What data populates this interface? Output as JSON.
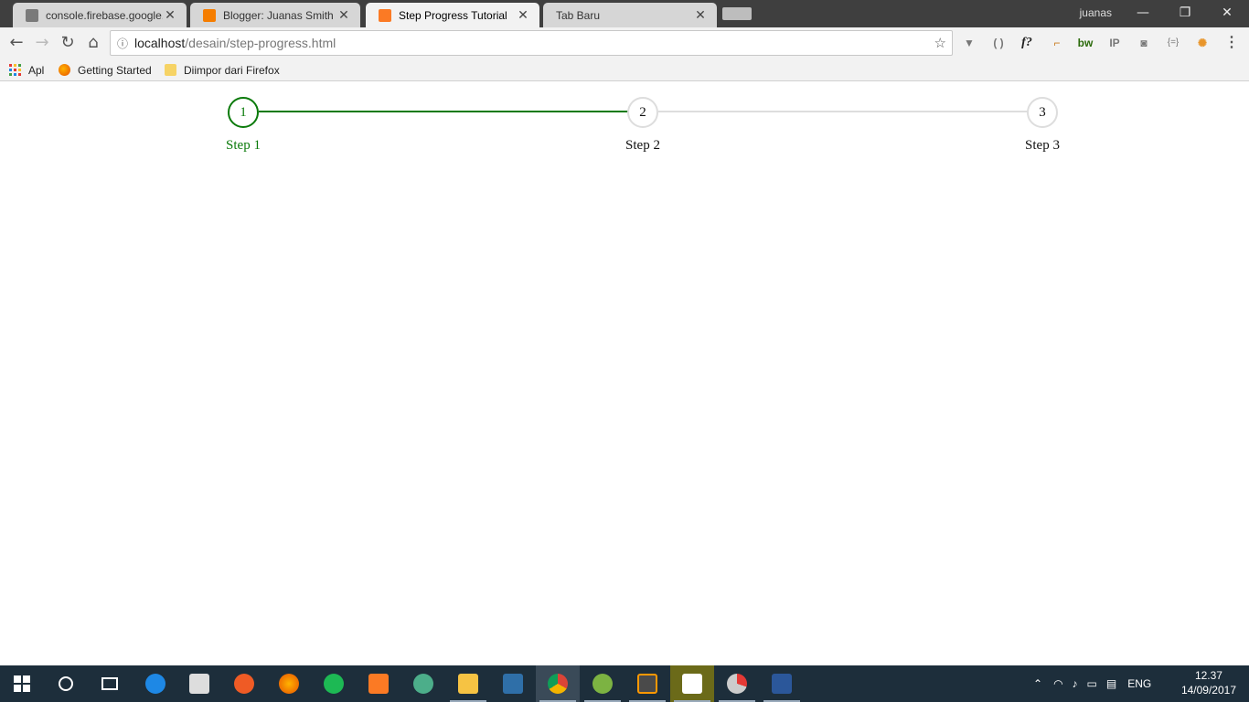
{
  "browser": {
    "tabs": [
      {
        "title": "console.firebase.google.c",
        "favicon": "firebase-icon"
      },
      {
        "title": "Blogger: Juanas Smith Sh",
        "favicon": "blogger-icon"
      },
      {
        "title": "Step Progress Tutorial",
        "favicon": "xampp-icon",
        "active": true
      },
      {
        "title": "Tab Baru",
        "favicon": "none"
      }
    ],
    "user_name": "juanas",
    "address": {
      "host": "localhost",
      "path": "/desain/step-progress.html"
    },
    "bookmarks": [
      {
        "label": "Apl",
        "icon": "apps-grid-icon"
      },
      {
        "label": "Getting Started",
        "icon": "firefox-icon"
      },
      {
        "label": "Diimpor dari Firefox",
        "icon": "folder-icon"
      }
    ],
    "extensions": [
      "vue-devtools-icon",
      "json-viewer-icon",
      "font-inspector-icon",
      "ruler-icon",
      "builtwith-icon",
      "ip-icon",
      "camera-icon",
      "json-formatter-icon",
      "cookie-icon"
    ]
  },
  "steps": {
    "items": [
      {
        "number": "1",
        "label": "Step 1",
        "state": "active"
      },
      {
        "number": "2",
        "label": "Step 2",
        "state": "pending"
      },
      {
        "number": "3",
        "label": "Step 3",
        "state": "pending"
      }
    ],
    "completed_segments": 1,
    "colors": {
      "active": "#0a7a0a",
      "inactive": "#dddddd"
    }
  },
  "taskbar": {
    "apps": [
      "start",
      "cortana",
      "task-view",
      "edge",
      "store",
      "postman",
      "firefox",
      "spotify",
      "xampp",
      "atom",
      "file-explorer",
      "app-window",
      "chrome",
      "android-studio",
      "sublime-text",
      "video-editor",
      "camera-app",
      "word"
    ],
    "language": "ENG",
    "time": "12.37",
    "date": "14/09/2017"
  }
}
